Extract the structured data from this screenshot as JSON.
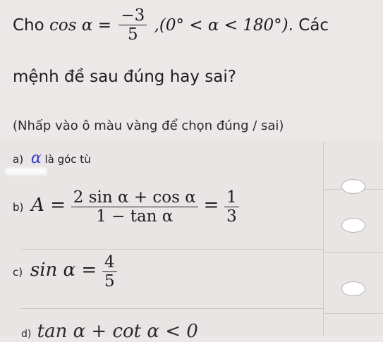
{
  "question": {
    "intro": "Cho",
    "cos_alpha_label": "cos α =",
    "value_num": "−3",
    "value_den": "5",
    "condition": ",(0° < α < 180°)",
    "after": ". Các",
    "line2": "mệnh đề sau đúng hay sai?"
  },
  "hint": "(Nhấp vào ô màu vàng để chọn đúng / sai)",
  "statements": [
    {
      "tag": "a)",
      "symbol": "α",
      "text": "là góc tù"
    },
    {
      "tag": "b)",
      "lhs": "A =",
      "num": "2 sin α + cos α",
      "den": "1 − tan α",
      "eq": "=",
      "rnum": "1",
      "rden": "3"
    },
    {
      "tag": "c)",
      "lhs": "sin α =",
      "num": "4",
      "den": "5"
    },
    {
      "tag": "d)",
      "partial": "tan α + cot α < 0"
    }
  ],
  "answer_icons": [
    "radio-empty",
    "radio-empty",
    "radio-empty"
  ]
}
